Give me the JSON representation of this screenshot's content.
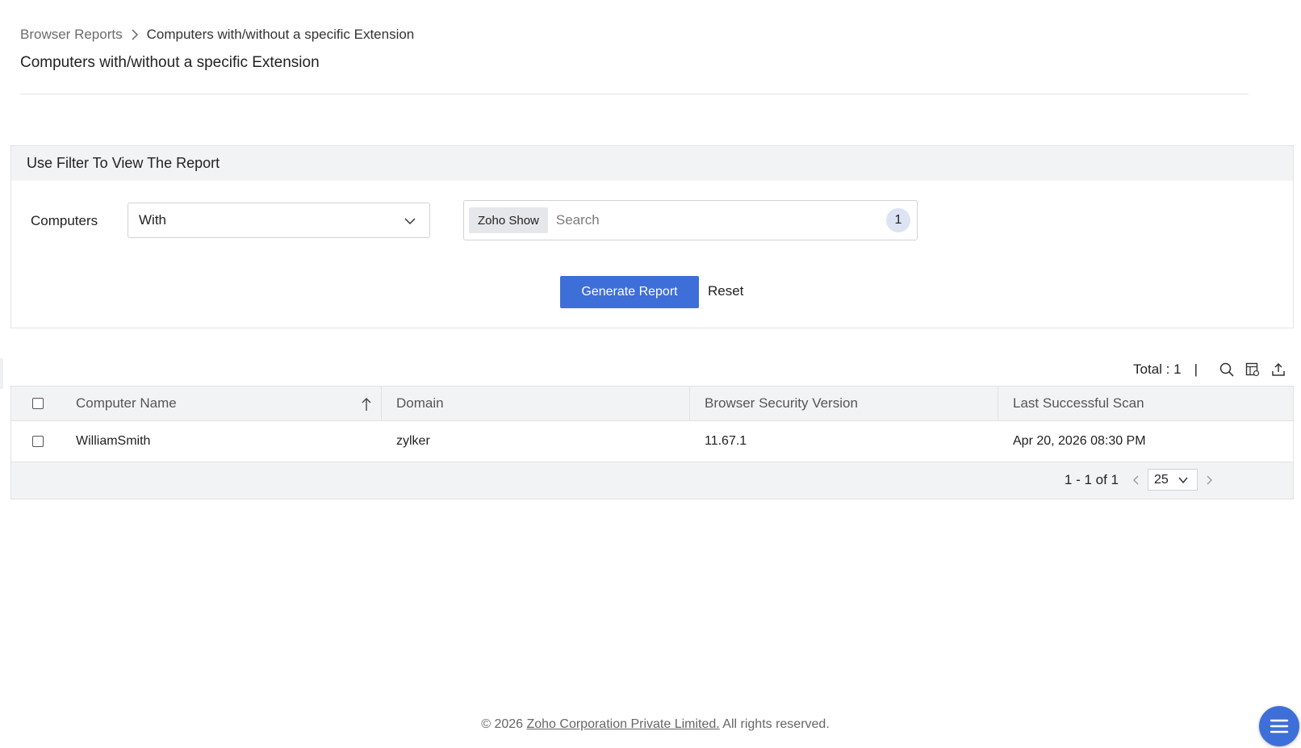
{
  "breadcrumb": {
    "parent": "Browser Reports",
    "current": "Computers with/without a specific Extension"
  },
  "page": {
    "title": "Computers with/without a specific Extension"
  },
  "filter": {
    "heading": "Use Filter To View The Report",
    "computers_label": "Computers",
    "condition_value": "With",
    "extension_chip": "Zoho Show",
    "search_placeholder": "Search",
    "selected_count": "1",
    "generate_label": "Generate Report",
    "reset_label": "Reset"
  },
  "toolbar": {
    "total": "Total : 1",
    "separator": "|"
  },
  "table": {
    "columns": [
      "Computer Name",
      "Domain",
      "Browser Security Version",
      "Last Successful Scan"
    ],
    "sorted_column": "Computer Name",
    "sort_direction": "ascending",
    "rows": [
      {
        "computer_name": "WilliamSmith",
        "domain": "zylker",
        "browser_security_version": "11.67.1",
        "last_successful_scan": "Apr 20, 2026 08:30 PM"
      }
    ]
  },
  "pagination": {
    "range": "1 - 1 of 1",
    "page_size": "25"
  },
  "footer": {
    "prefix": "© 2026",
    "company": "Zoho Corporation Private Limited.",
    "suffix": "All rights reserved."
  },
  "colors": {
    "accent": "#3e6fd8",
    "header_bg": "#f2f3f5",
    "badge_bg": "#dde3f2",
    "border": "#e2e2e2"
  },
  "icons": [
    "chevron-right-icon",
    "chevron-down-icon",
    "sort-ascending-icon",
    "search-icon",
    "column-settings-icon",
    "export-icon",
    "chevron-left-icon",
    "menu-icon"
  ]
}
